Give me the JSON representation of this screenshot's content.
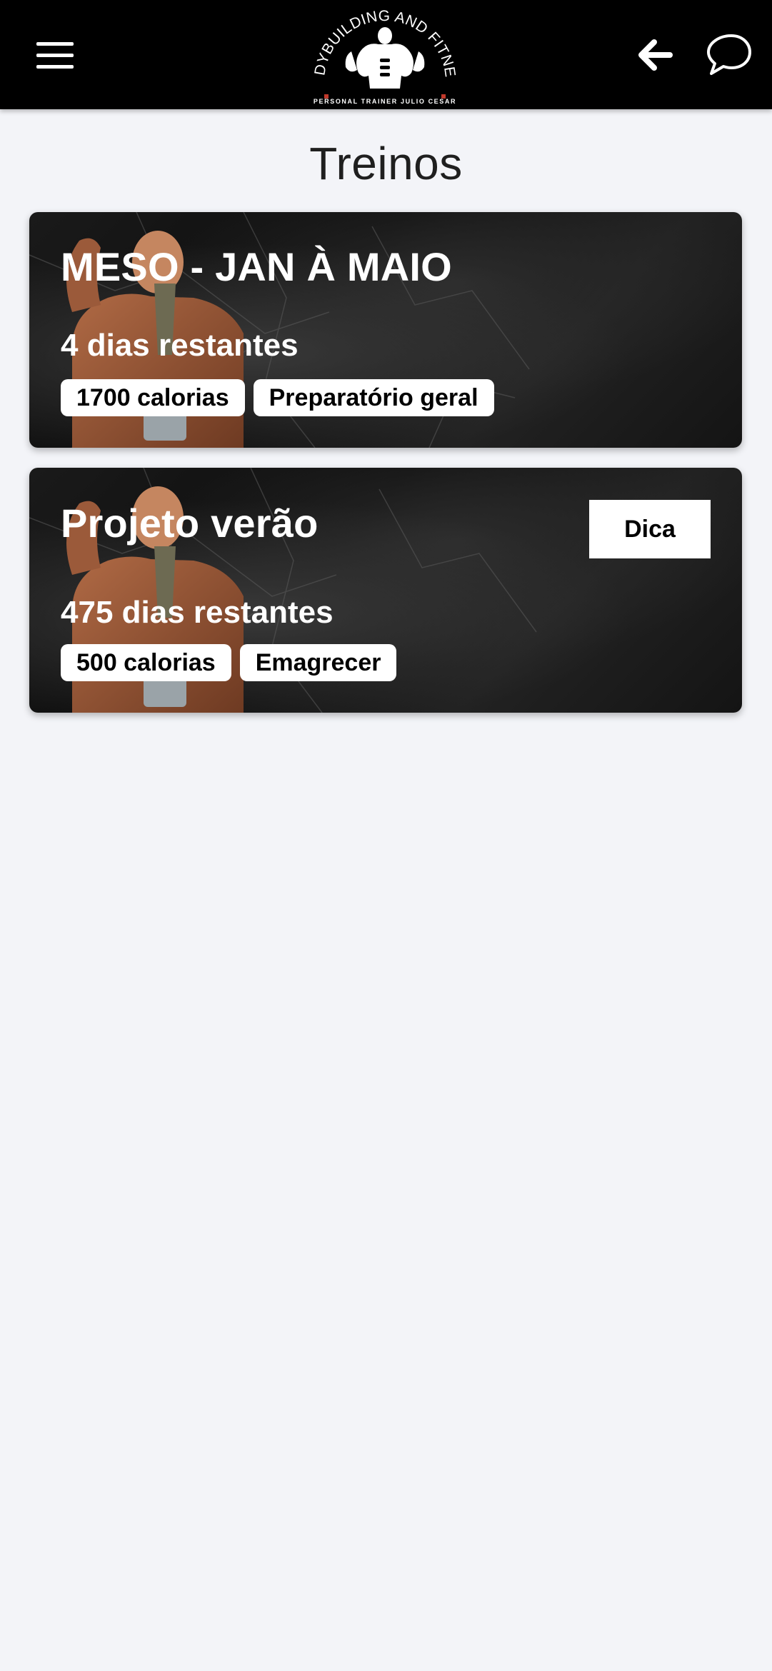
{
  "header": {
    "logo": {
      "text_top": "BODYBUILDING AND FITNESS",
      "text_bottom": "PERSONAL TRAINER JULIO CESAR"
    },
    "icons": {
      "menu": "hamburger-menu-icon",
      "back": "arrow-left-icon",
      "chat": "chat-bubble-icon"
    }
  },
  "page": {
    "title": "Treinos"
  },
  "workouts": [
    {
      "title": "MESO - JAN À MAIO",
      "days_remaining": "4 dias restantes",
      "tags": [
        "1700 calorias",
        "Preparatório geral"
      ]
    },
    {
      "title": "Projeto verão",
      "days_remaining": "475 dias restantes",
      "tags": [
        "500 calorias",
        "Emagrecer"
      ],
      "tip_label": "Dica"
    }
  ],
  "colors": {
    "header_bg": "#000000",
    "page_bg": "#f3f4f8",
    "card_text": "#ffffff",
    "tag_bg": "#ffffff"
  }
}
